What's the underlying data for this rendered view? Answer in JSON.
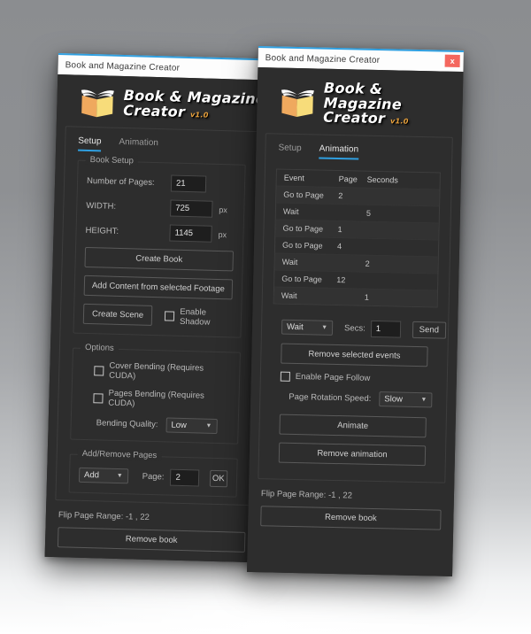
{
  "app": {
    "window_title": "Book and Magazine Creator",
    "brand_line1": "Book & Magazine",
    "brand_line2": "Creator",
    "version": "v1.0",
    "close_label": "x",
    "accent_color": "#2f9fe0",
    "version_color": "#e8a13c",
    "window_bg": "#2d2d2d"
  },
  "tabs": {
    "setup": "Setup",
    "animation": "Animation"
  },
  "left_window": {
    "active_tab": "Setup",
    "book_setup": {
      "legend": "Book Setup",
      "pages_label": "Number of Pages:",
      "pages_value": "21",
      "width_label": "WIDTH:",
      "width_value": "725",
      "width_unit": "px",
      "height_label": "HEIGHT:",
      "height_value": "1145",
      "height_unit": "px",
      "create_book": "Create Book",
      "add_content": "Add Content from selected Footage",
      "create_scene": "Create Scene",
      "enable_shadow": "Enable Shadow"
    },
    "options": {
      "legend": "Options",
      "cover_bending": "Cover Bending (Requires CUDA)",
      "pages_bending": "Pages Bending (Requires CUDA)",
      "bending_quality_label": "Bending Quality:",
      "bending_quality_value": "Low"
    },
    "add_remove": {
      "legend": "Add/Remove Pages",
      "action_value": "Add",
      "page_label": "Page:",
      "page_value": "2",
      "ok": "OK"
    },
    "flip_range": "Flip Page Range: -1 , 22",
    "remove_book": "Remove book"
  },
  "right_window": {
    "active_tab": "Animation",
    "events_table": {
      "columns": [
        "Event",
        "Page",
        "Seconds"
      ],
      "rows": [
        {
          "event": "Go to Page",
          "page": "2",
          "seconds": ""
        },
        {
          "event": "Wait",
          "page": "",
          "seconds": "5"
        },
        {
          "event": "Go to Page",
          "page": "1",
          "seconds": ""
        },
        {
          "event": "Go to Page",
          "page": "4",
          "seconds": ""
        },
        {
          "event": "Wait",
          "page": "",
          "seconds": "2"
        },
        {
          "event": "Go to Page",
          "page": "12",
          "seconds": ""
        },
        {
          "event": "Wait",
          "page": "",
          "seconds": "1"
        }
      ]
    },
    "controls": {
      "event_type_value": "Wait",
      "secs_label": "Secs:",
      "secs_value": "1",
      "send": "Send",
      "remove_selected": "Remove selected events",
      "enable_page_follow": "Enable Page Follow",
      "rotation_speed_label": "Page Rotation Speed:",
      "rotation_speed_value": "Slow",
      "animate": "Animate",
      "remove_animation": "Remove animation"
    },
    "flip_range": "Flip Page Range: -1 , 22",
    "remove_book": "Remove book"
  }
}
